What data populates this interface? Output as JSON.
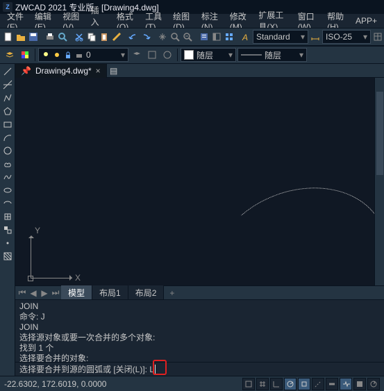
{
  "title": "ZWCAD 2021 专业版 - [Drawing4.dwg]",
  "menu": [
    "文件(F)",
    "编辑(E)",
    "视图(V)",
    "插入(I)",
    "格式(O)",
    "工具(T)",
    "绘图(D)",
    "标注(N)",
    "修改(M)",
    "扩展工具(X)",
    "窗口(W)",
    "帮助(H)",
    "APP+"
  ],
  "doc_tab": {
    "name": "Drawing4.dwg*",
    "close": "×"
  },
  "style_combo": "Standard",
  "dim_combo": "ISO-25",
  "layer_combo": "随层",
  "layer2_combo": "随层",
  "ucs": {
    "x": "X",
    "y": "Y"
  },
  "layout_tabs": {
    "model": "模型",
    "l1": "布局1",
    "l2": "布局2",
    "add": "+"
  },
  "cmd_history": [
    "JOIN",
    "命令: J",
    "JOIN",
    "选择源对象或要一次合并的多个对象:",
    "找到 1 个",
    "选择要合并的对象:"
  ],
  "cmd_prompt": "选择要合并到源的圆弧或 [关闭(L)]: L",
  "status": {
    "coords": "-22.6302, 172.6019, 0.0000"
  }
}
